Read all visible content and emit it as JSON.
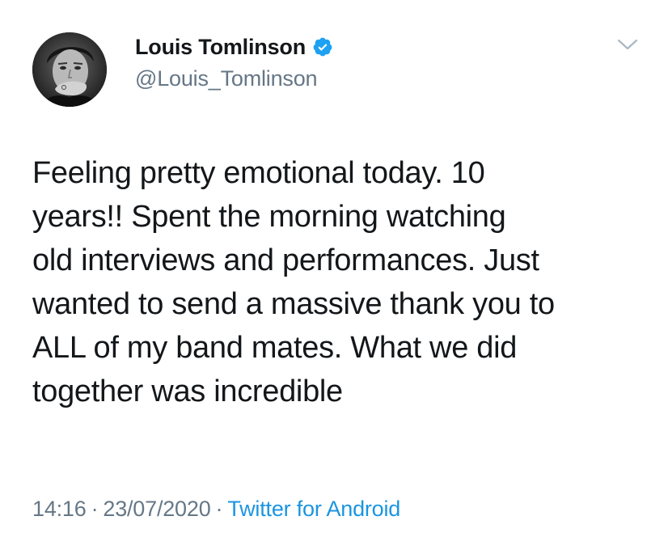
{
  "author": {
    "display_name": "Louis Tomlinson",
    "handle": "@Louis_Tomlinson",
    "verified": true,
    "avatar_icon": "profile-photo"
  },
  "menu": {
    "icon": "chevron-down-icon"
  },
  "tweet": {
    "lines": [
      "Feeling pretty emotional today. 10",
      "years!! Spent the morning watching",
      "old interviews and performances. Just",
      "wanted to send a massive thank you to",
      "ALL of my band mates. What we did",
      "together was incredible"
    ]
  },
  "meta": {
    "time": "14:16",
    "separator": "·",
    "date": "23/07/2020",
    "source": "Twitter for Android"
  },
  "colors": {
    "text": "#14171a",
    "secondary": "#657786",
    "link": "#1b95e0",
    "verified": "#1da1f2"
  }
}
